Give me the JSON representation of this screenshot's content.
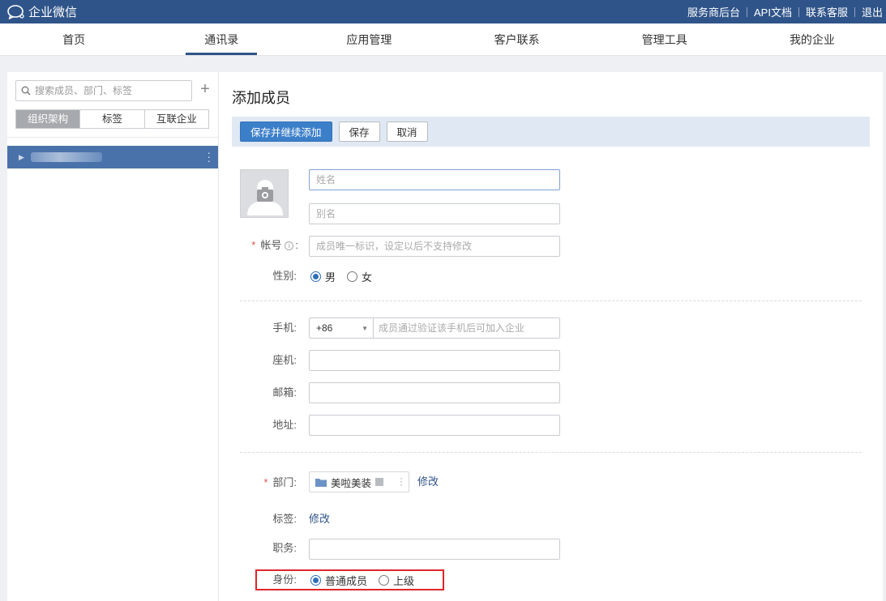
{
  "topbar": {
    "brand": "企业微信",
    "links": [
      "服务商后台",
      "API文档",
      "联系客服",
      "退出"
    ]
  },
  "nav": {
    "items": [
      "首页",
      "通讯录",
      "应用管理",
      "客户联系",
      "管理工具",
      "我的企业"
    ],
    "active_index": 1
  },
  "sidebar": {
    "search_placeholder": "搜索成员、部门、标签",
    "tabs": [
      "组织架构",
      "标签",
      "互联企业"
    ],
    "active_tab": 0
  },
  "form": {
    "title": "添加成员",
    "buttons": {
      "save_continue": "保存并继续添加",
      "save": "保存",
      "cancel": "取消"
    },
    "name_placeholder": "姓名",
    "alias_placeholder": "别名",
    "account_label": "帐号",
    "account_placeholder": "成员唯一标识，设定以后不支持修改",
    "gender_label": "性别:",
    "gender_options": [
      "男",
      "女"
    ],
    "gender_selected": "男",
    "mobile_label": "手机:",
    "country_code": "+86",
    "mobile_placeholder": "成员通过验证该手机后可加入企业",
    "landline_label": "座机:",
    "email_label": "邮箱:",
    "address_label": "地址:",
    "department_label": "部门:",
    "department_value": "美啦美装",
    "department_modify": "修改",
    "tag_label": "标签:",
    "tag_modify": "修改",
    "position_label": "职务:",
    "identity_label": "身份:",
    "identity_options": [
      "普通成员",
      "上级"
    ],
    "identity_selected": "普通成员"
  },
  "colors": {
    "topbar": "#2f5489",
    "primary_button": "#3c7fc9",
    "selected_tree_row": "#4a72aa",
    "highlight_box": "#e0262a"
  }
}
